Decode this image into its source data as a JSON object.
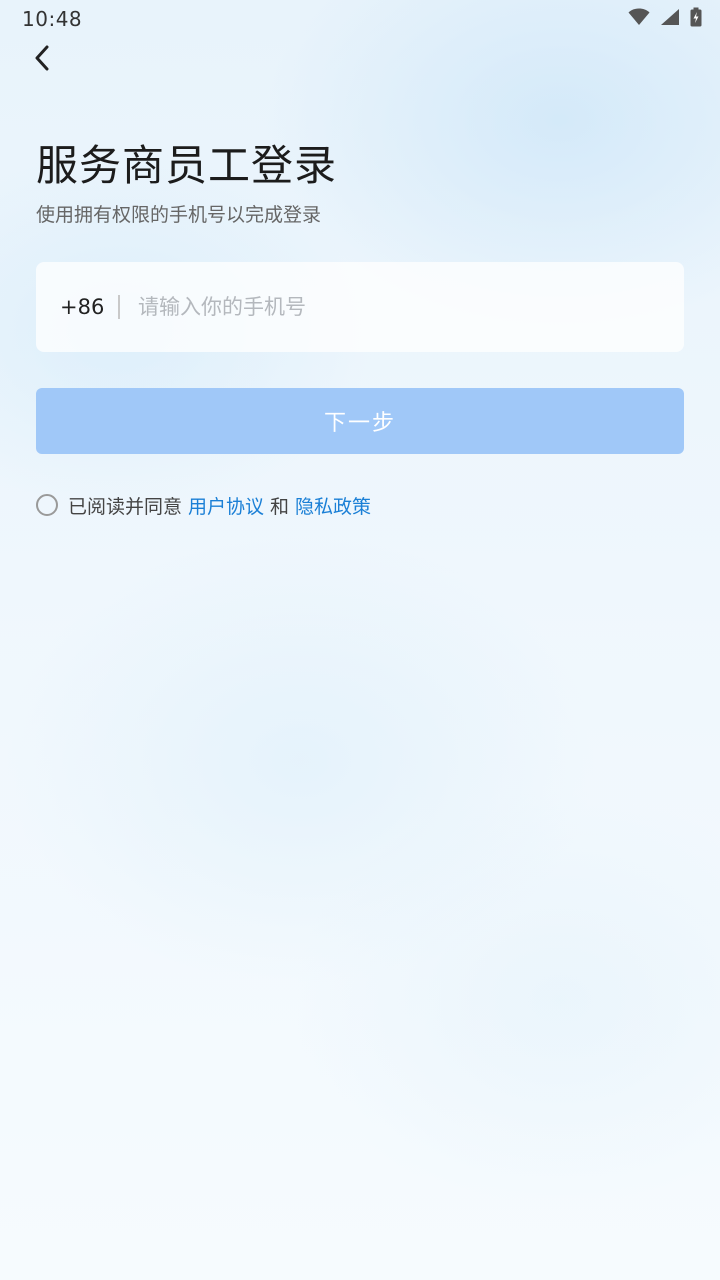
{
  "status_bar": {
    "time": "10:48"
  },
  "page": {
    "title": "服务商员工登录",
    "subtitle": "使用拥有权限的手机号以完成登录"
  },
  "phone": {
    "country_code": "+86",
    "placeholder": "请输入你的手机号",
    "value": ""
  },
  "next_button": {
    "label": "下一步"
  },
  "agreement": {
    "prefix": "已阅读并同意",
    "user_agreement": "用户协议",
    "conjunction": "和",
    "privacy_policy": "隐私政策",
    "checked": false
  },
  "colors": {
    "primary_disabled": "#a0c8f8",
    "link": "#1a7fd6"
  },
  "icons": {
    "back": "chevron-left-icon",
    "wifi": "wifi-icon",
    "signal": "signal-icon",
    "battery": "battery-charging-icon"
  }
}
